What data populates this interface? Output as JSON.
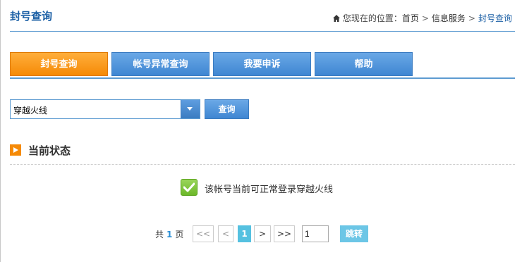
{
  "header": {
    "title": "封号查询",
    "breadcrumb": {
      "prefix": "您现在的位置：",
      "items": [
        "首页",
        "信息服务",
        "封号查询"
      ],
      "separator": ">"
    }
  },
  "tabs": [
    {
      "label": "封号查询",
      "active": true
    },
    {
      "label": "帐号异常查询",
      "active": false
    },
    {
      "label": "我要申诉",
      "active": false
    },
    {
      "label": "帮助",
      "active": false
    }
  ],
  "query": {
    "selected_game": "穿越火线",
    "button_label": "查询"
  },
  "status_section": {
    "title": "当前状态",
    "message": "该帐号当前可正常登录穿越火线"
  },
  "pagination": {
    "total_prefix": "共",
    "total_pages": "1",
    "total_suffix": "页",
    "first_label": "<<",
    "prev_label": "<",
    "current_page": "1",
    "next_label": ">",
    "last_label": ">>",
    "page_input_value": "1",
    "jump_label": "跳转"
  },
  "colors": {
    "accent_blue": "#3f86d2",
    "active_orange": "#f58a07",
    "success_green": "#6cb829",
    "current_page": "#55c1e0"
  }
}
